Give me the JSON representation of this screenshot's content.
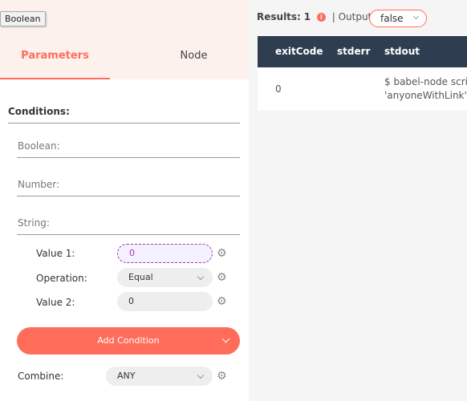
{
  "tooltip": "Boolean",
  "tabs": {
    "parameters": "Parameters",
    "node": "Node"
  },
  "conditions": {
    "label": "Conditions:",
    "boolean_label": "Boolean:",
    "number_label": "Number:",
    "string_label": "String:",
    "value1_label": "Value 1:",
    "value1": "0",
    "operation_label": "Operation:",
    "operation": "Equal",
    "value2_label": "Value 2:",
    "value2": "0",
    "add_condition": "Add Condition",
    "combine_label": "Combine:",
    "combine": "ANY"
  },
  "results": {
    "label": "Results:",
    "count": "1",
    "output_label": "Output:",
    "output": "false"
  },
  "table": {
    "headers": [
      "exitCode",
      "stderr",
      "stdout"
    ],
    "row": {
      "exitCode": "0",
      "stderr": "",
      "stdout_line1": "$ babel-node scrip",
      "stdout_line2": "'anyoneWithLink', t"
    }
  },
  "colors": {
    "accent": "#ff6d5a",
    "table_header": "#2e3d4f"
  },
  "icons": {
    "gear": "gear-icon",
    "info": "info-icon"
  }
}
